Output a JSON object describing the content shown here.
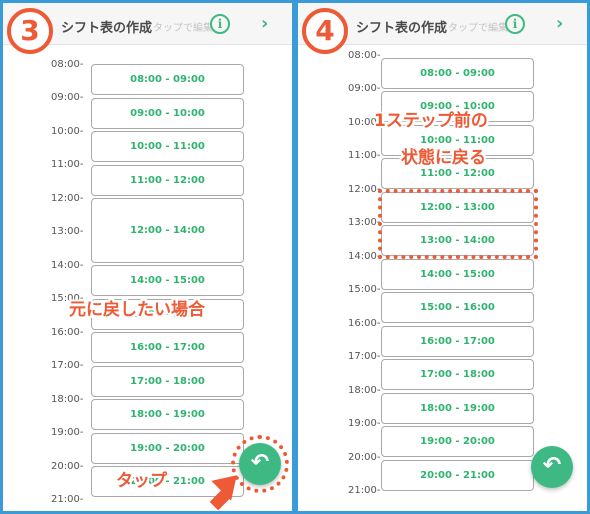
{
  "header": {
    "back_glyph": "‹",
    "title": "シフト表の作成",
    "hint": "タップで編集",
    "info_glyph": "i",
    "next_glyph": "›"
  },
  "left_panel": {
    "step": "3",
    "time_labels": [
      "08:00-",
      "09:00-",
      "10:00-",
      "11:00-",
      "12:00-",
      "13:00-",
      "14:00-",
      "15:00-",
      "16:00-",
      "17:00-",
      "18:00-",
      "19:00-",
      "20:00-",
      "21:00-"
    ],
    "slots": [
      "08:00 - 09:00",
      "09:00 - 10:00",
      "10:00 - 11:00",
      "11:00 - 12:00",
      "12:00 - 14:00",
      "14:00 - 15:00",
      "15:00 - 16:00",
      "16:00 - 17:00",
      "17:00 - 18:00",
      "18:00 - 19:00",
      "19:00 - 20:00",
      "20:00 - 21:00"
    ],
    "annotation_undo": "元に戻したい場合",
    "annotation_tap": "タップ",
    "fab_glyph": "↶"
  },
  "right_panel": {
    "step": "4",
    "time_labels": [
      "08:00-",
      "09:00-",
      "10:00-",
      "11:00-",
      "12:00-",
      "13:00-",
      "14:00-",
      "15:00-",
      "16:00-",
      "17:00-",
      "18:00-",
      "19:00-",
      "20:00-",
      "21:00-"
    ],
    "slots": [
      "08:00 - 09:00",
      "09:00 - 10:00",
      "10:00 - 11:00",
      "11:00 - 12:00",
      "12:00 - 13:00",
      "13:00 - 14:00",
      "14:00 - 15:00",
      "15:00 - 16:00",
      "16:00 - 17:00",
      "17:00 - 18:00",
      "18:00 - 19:00",
      "19:00 - 20:00",
      "20:00 - 21:00"
    ],
    "annotation_line1": "1ステップ前の",
    "annotation_line2": "状態に戻る",
    "fab_glyph": "↶"
  },
  "colors": {
    "accent_green": "#3fb983",
    "annotation_red": "#ee5a36",
    "border_blue": "#3b9bd9"
  }
}
